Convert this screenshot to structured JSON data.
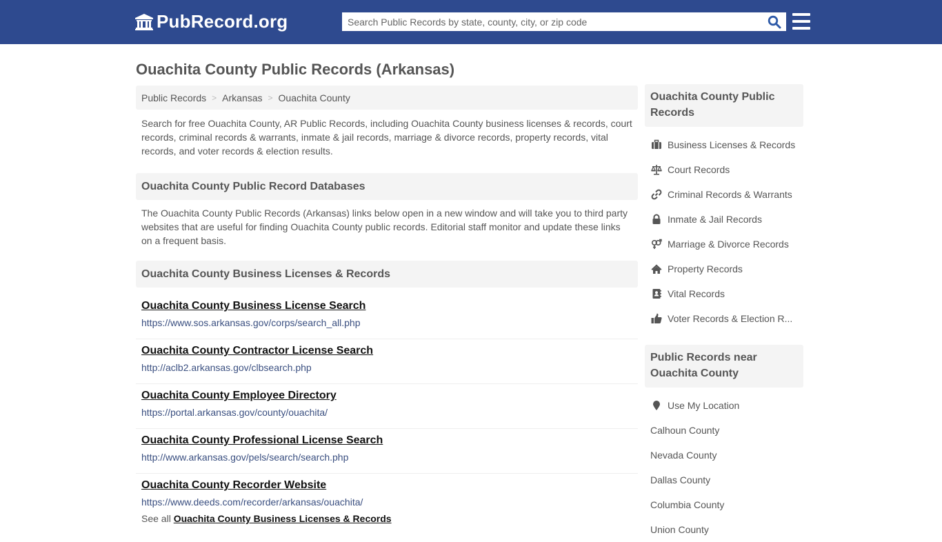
{
  "header": {
    "logo_text": "PubRecord.org",
    "search_placeholder": "Search Public Records by state, county, city, or zip code",
    "search_value": "",
    "brand_color": "#2e4a8f"
  },
  "page": {
    "title": "Ouachita County Public Records (Arkansas)"
  },
  "breadcrumb": [
    {
      "label": "Public Records"
    },
    {
      "label": "Arkansas"
    },
    {
      "label": "Ouachita County"
    }
  ],
  "intro_text": "Search for free Ouachita County, AR Public Records, including Ouachita County business licenses & records, court records, criminal records & warrants, inmate & jail records, marriage & divorce records, property records, vital records, and voter records & election results.",
  "databases": {
    "heading": "Ouachita County Public Record Databases",
    "description": "The Ouachita County Public Records (Arkansas) links below open in a new window and will take you to third party websites that are useful for finding Ouachita County public records. Editorial staff monitor and update these links on a frequent basis."
  },
  "business_section": {
    "heading": "Ouachita County Business Licenses & Records",
    "links": [
      {
        "title": "Ouachita County Business License Search",
        "url": "https://www.sos.arkansas.gov/corps/search_all.php"
      },
      {
        "title": "Ouachita County Contractor License Search",
        "url": "http://aclb2.arkansas.gov/clbsearch.php"
      },
      {
        "title": "Ouachita County Employee Directory",
        "url": "https://portal.arkansas.gov/county/ouachita/"
      },
      {
        "title": "Ouachita County Professional License Search",
        "url": "http://www.arkansas.gov/pels/search/search.php"
      },
      {
        "title": "Ouachita County Recorder Website",
        "url": "https://www.deeds.com/recorder/arkansas/ouachita/"
      }
    ],
    "see_all_prefix": "See all",
    "see_all_link": "Ouachita County Business Licenses & Records"
  },
  "sidebar": {
    "records_heading": "Ouachita County Public Records",
    "records_items": [
      {
        "label": "Business Licenses & Records",
        "icon": "briefcase-icon"
      },
      {
        "label": "Court Records",
        "icon": "balance-scale-icon"
      },
      {
        "label": "Criminal Records & Warrants",
        "icon": "link-icon"
      },
      {
        "label": "Inmate & Jail Records",
        "icon": "lock-icon"
      },
      {
        "label": "Marriage & Divorce Records",
        "icon": "venus-mars-icon"
      },
      {
        "label": "Property Records",
        "icon": "home-icon"
      },
      {
        "label": "Vital Records",
        "icon": "address-book-icon"
      },
      {
        "label": "Voter Records & Election R...",
        "icon": "thumbs-up-icon"
      }
    ],
    "near_heading": "Public Records near Ouachita County",
    "use_location": "Use My Location",
    "near_items": [
      {
        "label": "Calhoun County"
      },
      {
        "label": "Nevada County"
      },
      {
        "label": "Dallas County"
      },
      {
        "label": "Columbia County"
      },
      {
        "label": "Union County"
      }
    ]
  }
}
